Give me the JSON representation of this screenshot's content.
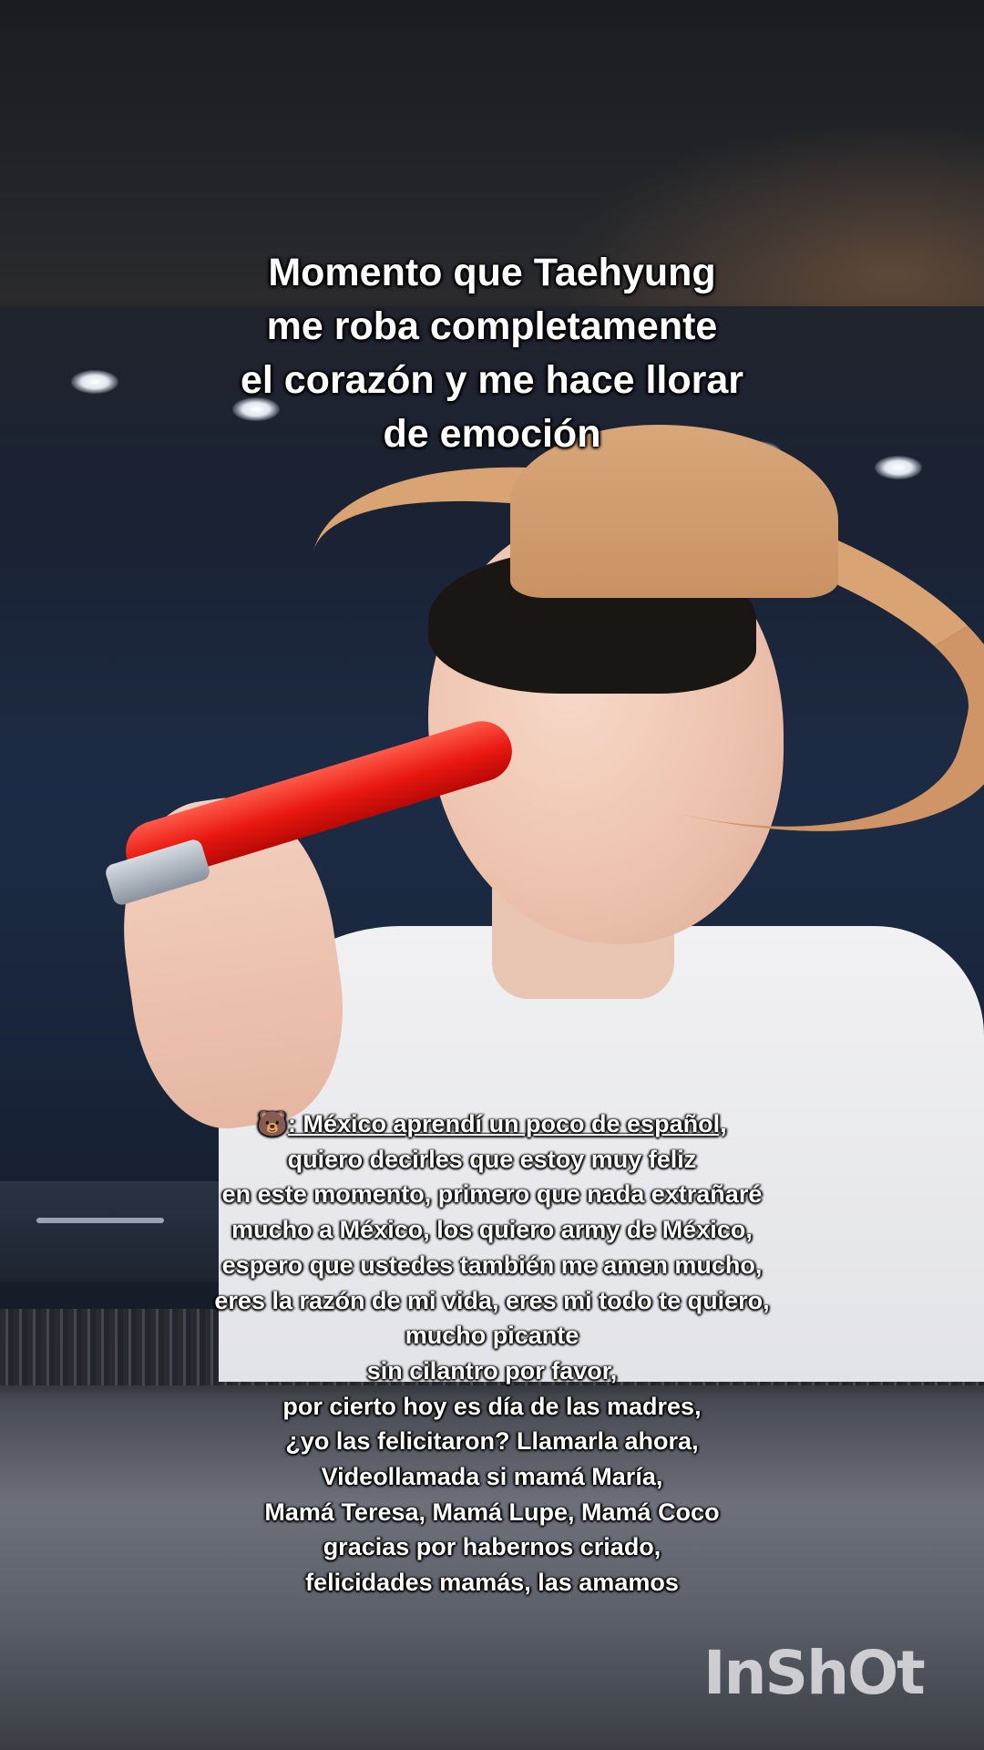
{
  "overlay": {
    "title_lines": [
      "Momento que Taehyung",
      "me roba completamente",
      "el corazón y me hace llorar",
      "de emoción"
    ],
    "subtitle_emoji": "🐻",
    "subtitle_lines": [
      ": México aprendí un poco de español,",
      "quiero decirles que estoy muy feliz",
      "en este momento, primero que nada extrañaré",
      "mucho a México, los quiero army de México,",
      "espero que ustedes también me amen mucho,",
      "eres la razón de mi vida, eres mi todo te quiero,",
      "mucho picante",
      "sin cilantro por favor,",
      "por cierto hoy es día de las madres,",
      "¿yo las felicitaron? Llamarla ahora,",
      "Videollamada si mamá María,",
      "Mamá Teresa, Mamá Lupe, Mamá Coco",
      "gracias por habernos criado,",
      "felicidades mamás, las amamos"
    ]
  },
  "watermark": {
    "text": "InShOt"
  },
  "colors": {
    "text": "#ffffff",
    "text_outline": "#000000",
    "mic": "#e8160f",
    "hat": "#d9a373"
  }
}
